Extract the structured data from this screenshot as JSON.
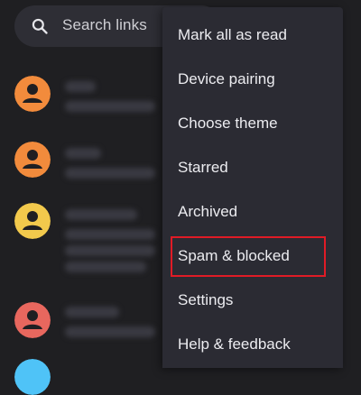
{
  "search": {
    "placeholder": "Search links",
    "icon": "search-icon"
  },
  "conversations": [
    {
      "avatar_color": "#f28b3c"
    },
    {
      "avatar_color": "#f28b3c"
    },
    {
      "avatar_color": "#f2c94c"
    },
    {
      "avatar_color": "#e8675e"
    },
    {
      "avatar_color": "#4fc3f7"
    }
  ],
  "menu": {
    "items": [
      {
        "label": "Mark all as read"
      },
      {
        "label": "Device pairing"
      },
      {
        "label": "Choose theme"
      },
      {
        "label": "Starred"
      },
      {
        "label": "Archived"
      },
      {
        "label": "Spam & blocked",
        "highlighted": true
      },
      {
        "label": "Settings"
      },
      {
        "label": "Help & feedback"
      }
    ]
  },
  "colors": {
    "background": "#1f1f22",
    "menu_background": "#2b2b33",
    "highlight_border": "#e01b26"
  }
}
